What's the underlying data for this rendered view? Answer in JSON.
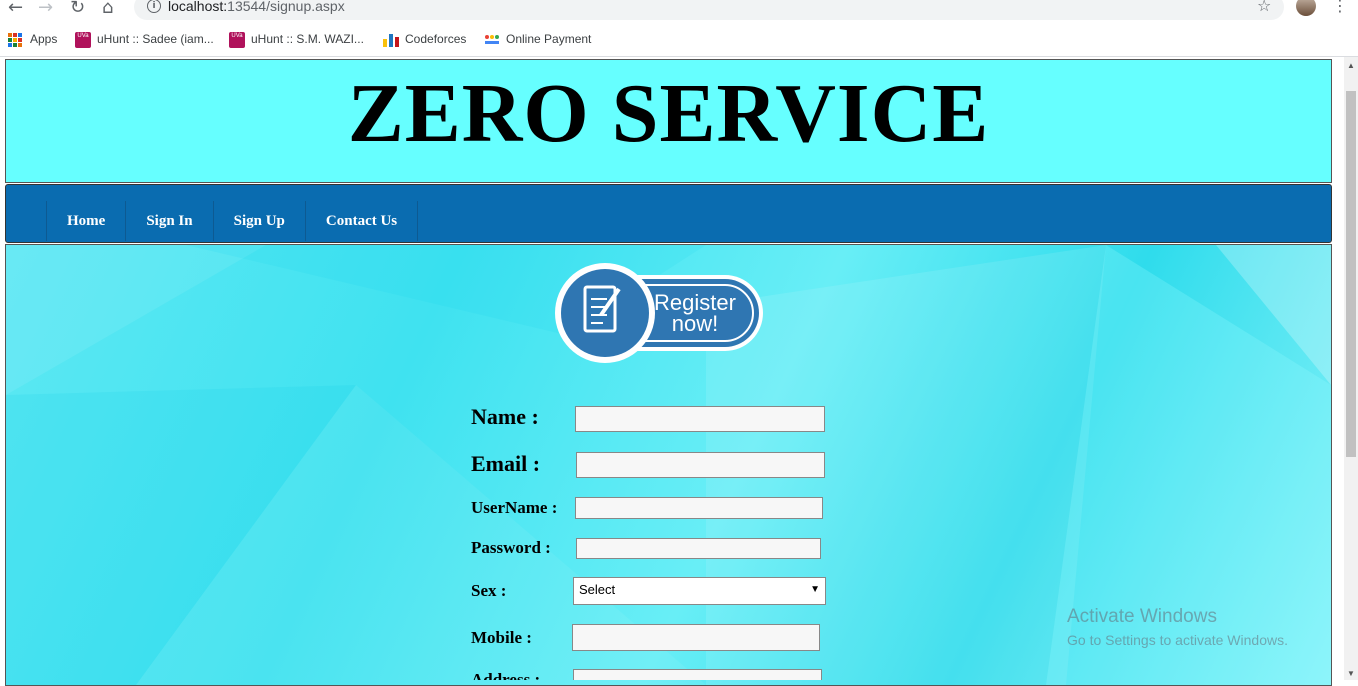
{
  "browser": {
    "url_host": "localhost:",
    "url_rest": "13544/signup.aspx",
    "back_icon": "arrow-left-icon",
    "forward_icon": "arrow-right-icon",
    "reload_icon": "reload-icon",
    "home_icon": "home-icon",
    "bookmarks": [
      {
        "label": "Apps"
      },
      {
        "label": "uHunt :: Sadee (iam..."
      },
      {
        "label": "uHunt :: S.M. WAZI..."
      },
      {
        "label": "Codeforces"
      },
      {
        "label": "Online Payment"
      }
    ]
  },
  "site": {
    "title": "ZERO SERVICE",
    "nav": [
      {
        "label": "Home"
      },
      {
        "label": "Sign In"
      },
      {
        "label": "Sign Up"
      },
      {
        "label": "Contact Us"
      }
    ],
    "colors": {
      "header_bg": "#66ffff",
      "navbar_bg": "#0a6cb0",
      "badge": "#2f76b2"
    }
  },
  "register_badge": {
    "line1": "Register",
    "line2": "now!"
  },
  "form": {
    "name_label": "Name :",
    "email_label": "Email :",
    "username_label": "UserName :",
    "password_label": "Password :",
    "sex_label": "Sex :",
    "sex_value": "Select",
    "mobile_label": "Mobile :",
    "address_label": "Address :"
  },
  "watermark": {
    "title": "Activate Windows",
    "subtitle": "Go to Settings to activate Windows."
  }
}
